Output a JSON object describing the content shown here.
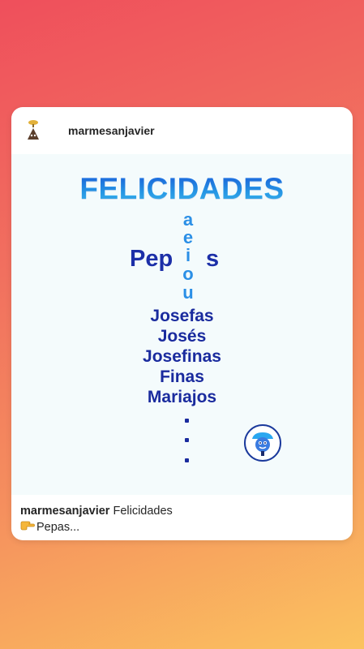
{
  "post": {
    "username": "marmesanjavier",
    "image": {
      "title": "FELICIDADES",
      "pep": "Pep",
      "vowels": [
        "a",
        "e",
        "i",
        "o",
        "u"
      ],
      "s": "s",
      "names": [
        "Josefas",
        "Josés",
        "Josefinas",
        "Finas",
        "Mariajos"
      ],
      "dots": [
        ".",
        ".",
        "."
      ]
    },
    "caption": {
      "username": "marmesanjavier",
      "text": "Felicidades",
      "pointer_icon": "backhand-index-pointing-right-icon",
      "second_line": "Pepas..."
    }
  },
  "colors": {
    "title_blue": "#1f7fe4",
    "dark_blue": "#1a2b9e",
    "vowel_blue": "#2b8fe6",
    "gradient_top": "#ef4f5c",
    "gradient_bottom": "#fbc35f"
  }
}
